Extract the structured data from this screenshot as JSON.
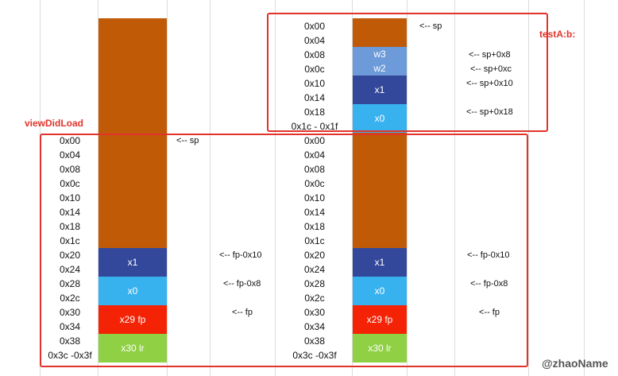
{
  "colors": {
    "stack_fill": "#c05a07",
    "dark_blue": "#33489a",
    "mid_blue": "#6d9ad8",
    "light_blue": "#38b1ef",
    "red": "#f42305",
    "green": "#8fd044",
    "frame_border": "#e2332b"
  },
  "frames": {
    "testA": "testA:b:",
    "viewDidLoad": "viewDidLoad"
  },
  "stack_a_addresses": [
    "0x00",
    "0x04",
    "0x08",
    "0x0c",
    "0x10",
    "0x14",
    "0x18",
    "0x1c",
    "0x20",
    "0x24",
    "0x28",
    "0x2c",
    "0x30",
    "0x34",
    "0x38",
    "0x3c -0x3f"
  ],
  "stack_a_blocks": [
    {
      "label": "x1",
      "color": "dark_blue"
    },
    {
      "label": "x0",
      "color": "light_blue"
    },
    {
      "label": "x29 fp",
      "color": "red"
    },
    {
      "label": "x30 lr",
      "color": "green"
    }
  ],
  "stack_a_notes": [
    "<-- sp",
    "<-- fp-0x10",
    "<-- fp-0x8",
    "<-- fp"
  ],
  "stack_b_top_addresses": [
    "0x00",
    "0x04",
    "0x08",
    "0x0c",
    "0x10",
    "0x14",
    "0x18",
    "0x1c - 0x1f"
  ],
  "stack_b_top_blocks": [
    {
      "label": "w3",
      "color": "mid_blue"
    },
    {
      "label": "w2",
      "color": "mid_blue"
    },
    {
      "label": "x1",
      "color": "dark_blue"
    },
    {
      "label": "x0",
      "color": "light_blue"
    }
  ],
  "stack_b_top_notes": [
    "<-- sp",
    "<-- sp+0x8",
    "<-- sp+0xc",
    "<-- sp+0x10",
    "<-- sp+0x18"
  ],
  "stack_b_addresses": [
    "0x00",
    "0x04",
    "0x08",
    "0x0c",
    "0x10",
    "0x14",
    "0x18",
    "0x1c",
    "0x20",
    "0x24",
    "0x28",
    "0x2c",
    "0x30",
    "0x34",
    "0x38",
    "0x3c -0x3f"
  ],
  "stack_b_blocks": [
    {
      "label": "x1",
      "color": "dark_blue"
    },
    {
      "label": "x0",
      "color": "light_blue"
    },
    {
      "label": "x29 fp",
      "color": "red"
    },
    {
      "label": "x30 lr",
      "color": "green"
    }
  ],
  "stack_b_notes": [
    "<-- fp-0x10",
    "<-- fp-0x8",
    "<-- fp"
  ],
  "watermark": "@zhaoName"
}
